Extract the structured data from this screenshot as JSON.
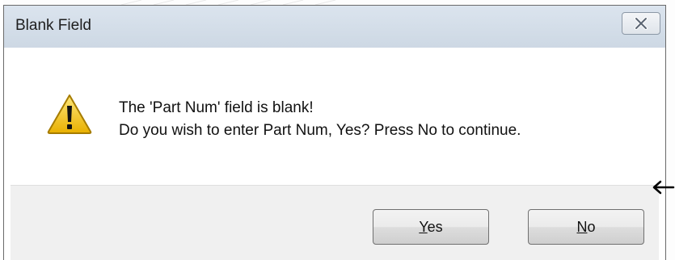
{
  "window": {
    "title": "Blank Field",
    "close_icon": "close-icon"
  },
  "message": {
    "line1": "The 'Part Num' field is blank!",
    "line2": "Do you wish to enter Part Num, Yes?  Press No to continue.",
    "icon": "warning-icon"
  },
  "buttons": {
    "yes": {
      "mnemonic": "Y",
      "rest": "es"
    },
    "no": {
      "mnemonic": "N",
      "rest": "o"
    }
  },
  "annotation": {
    "icon": "arrow-left-icon"
  },
  "colors": {
    "title_bar": "#cdd8e4",
    "footer": "#f0f0f0",
    "warning_yellow": "#f3c300"
  }
}
